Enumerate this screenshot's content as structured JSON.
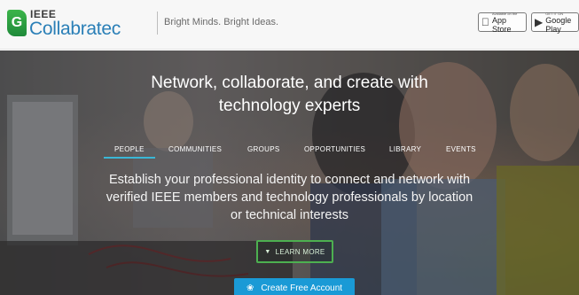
{
  "header": {
    "logo": {
      "mark": "G",
      "ieee": "IEEE",
      "name": "Collabratec"
    },
    "tagline": "Bright Minds. Bright Ideas.",
    "store_badges": [
      {
        "name": "app-store",
        "icon": "apple-icon",
        "small": "Available on the",
        "label": "App Store"
      },
      {
        "name": "google-play",
        "icon": "play-icon",
        "small": "GET IT ON",
        "label": "Google Play"
      }
    ]
  },
  "hero": {
    "title_lines": [
      "Network, collaborate, and create with",
      "technology experts"
    ],
    "nav": [
      {
        "label": "PEOPLE",
        "active": true
      },
      {
        "label": "COMMUNITIES",
        "active": false
      },
      {
        "label": "GROUPS",
        "active": false
      },
      {
        "label": "OPPORTUNITIES",
        "active": false
      },
      {
        "label": "LIBRARY",
        "active": false
      },
      {
        "label": "EVENTS",
        "active": false
      }
    ],
    "description_lines": [
      "Establish your professional identity to connect and network with",
      "verified IEEE members and technology professionals by location",
      "or technical interests"
    ],
    "learn_more": {
      "icon": "chevron-down-icon",
      "label": "LEARN MORE"
    },
    "cta": {
      "icon": "person-icon",
      "label": "Create Free Account"
    }
  },
  "colors": {
    "accent": "#1a9ad6",
    "active_underline": "#3ab7d6",
    "learn_more_border": "#4db050",
    "logo_green": "#3cb54a",
    "logo_blue": "#2a7fb7"
  }
}
